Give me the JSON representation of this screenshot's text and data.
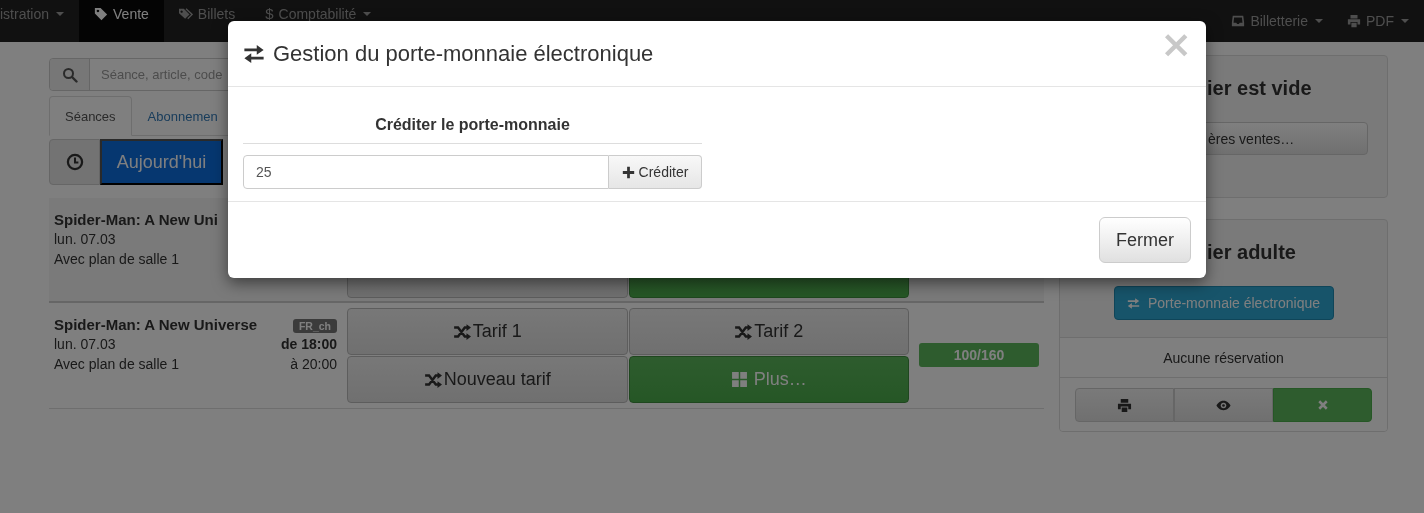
{
  "navbar": {
    "left": [
      {
        "label": "istration",
        "kind": "plain",
        "dropdown": true,
        "selected": false
      },
      {
        "label": "Vente",
        "kind": "tag",
        "dropdown": false,
        "selected": true
      },
      {
        "label": "Billets",
        "kind": "tags",
        "dropdown": false,
        "selected": false
      },
      {
        "label": "Comptabilité",
        "kind": "symbol",
        "symbol": "$",
        "dropdown": true,
        "selected": false
      }
    ],
    "right": [
      {
        "label": "Billetterie",
        "kind": "inbox",
        "dropdown": true
      },
      {
        "label": "PDF",
        "kind": "print",
        "dropdown": true
      }
    ]
  },
  "search": {
    "placeholder": "Séance, article, code"
  },
  "tabs": [
    {
      "label": "Séances",
      "selected": true
    },
    {
      "label": "Abonnemen",
      "selected": false
    }
  ],
  "date_filter": {
    "label": "Aujourd'hui"
  },
  "screenings": [
    {
      "title": "Spider-Man: A New Uni",
      "date": "lun. 07.03",
      "room": "Avec plan de salle 1",
      "tariffs": [
        {
          "kind": "tariff"
        },
        {
          "kind": "more"
        }
      ]
    },
    {
      "title": "Spider-Man: A New Universe",
      "language": "FR_ch",
      "date": "lun. 07.03",
      "start": "de 18:00",
      "room": "Avec plan de salle 1",
      "end": "à 20:00",
      "capacity": "100/160",
      "tariffs": [
        {
          "kind": "tariff",
          "label": "Tarif 1"
        },
        {
          "kind": "tariff",
          "label": "Tarif 2"
        },
        {
          "kind": "tariff",
          "label": "Nouveau tarif"
        },
        {
          "kind": "more",
          "label": "Plus…"
        }
      ]
    }
  ],
  "cart": {
    "heading": "ier est vide",
    "button": "ères ventes…"
  },
  "customer": {
    "heading": "ier adulte",
    "wallet_button": "Porte-monnaie électronique",
    "reservations": "Aucune réservation",
    "actions": [
      {
        "kind": "print"
      },
      {
        "kind": "view"
      },
      {
        "kind": "remove"
      }
    ]
  },
  "modal": {
    "title": "Gestion du porte-monnaie électronique",
    "close": "×",
    "section_title": "Créditer le porte-monnaie",
    "amount": "25",
    "credit_button": "Créditer",
    "footer_button": "Fermer"
  }
}
